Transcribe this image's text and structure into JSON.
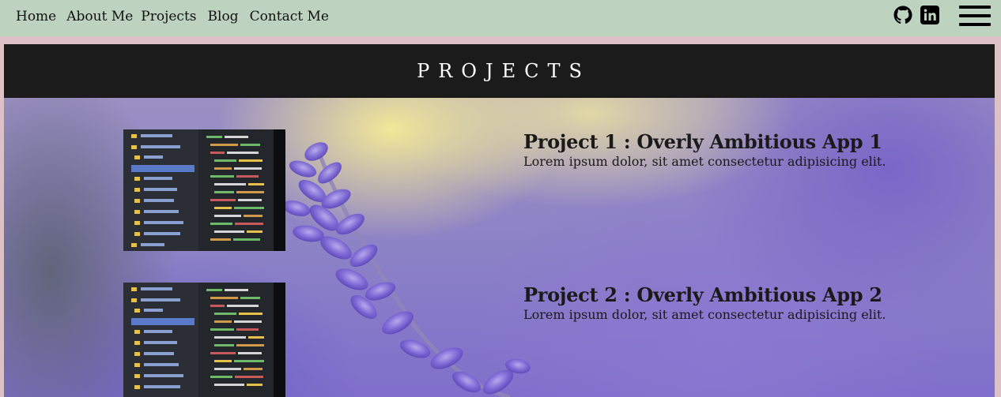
{
  "nav": {
    "links": [
      "Home",
      "About Me",
      "Projects",
      "Blog",
      "Contact Me"
    ],
    "icons": [
      "github-icon",
      "linkedin-icon"
    ],
    "menu_icon": "hamburger-menu-icon"
  },
  "colors": {
    "nav_bg": "#bdd3bf",
    "page_bg": "#dcc2c7",
    "header_bg": "#1b1b1b"
  },
  "section": {
    "title": "PROJECTS"
  },
  "projects": [
    {
      "title": "Project 1 : Overly Ambitious App 1",
      "description": "Lorem ipsum dolor, sit amet consectetur adipisicing elit."
    },
    {
      "title": "Project 2 : Overly Ambitious App 2",
      "description": "Lorem ipsum dolor, sit amet consectetur adipisicing elit."
    }
  ]
}
